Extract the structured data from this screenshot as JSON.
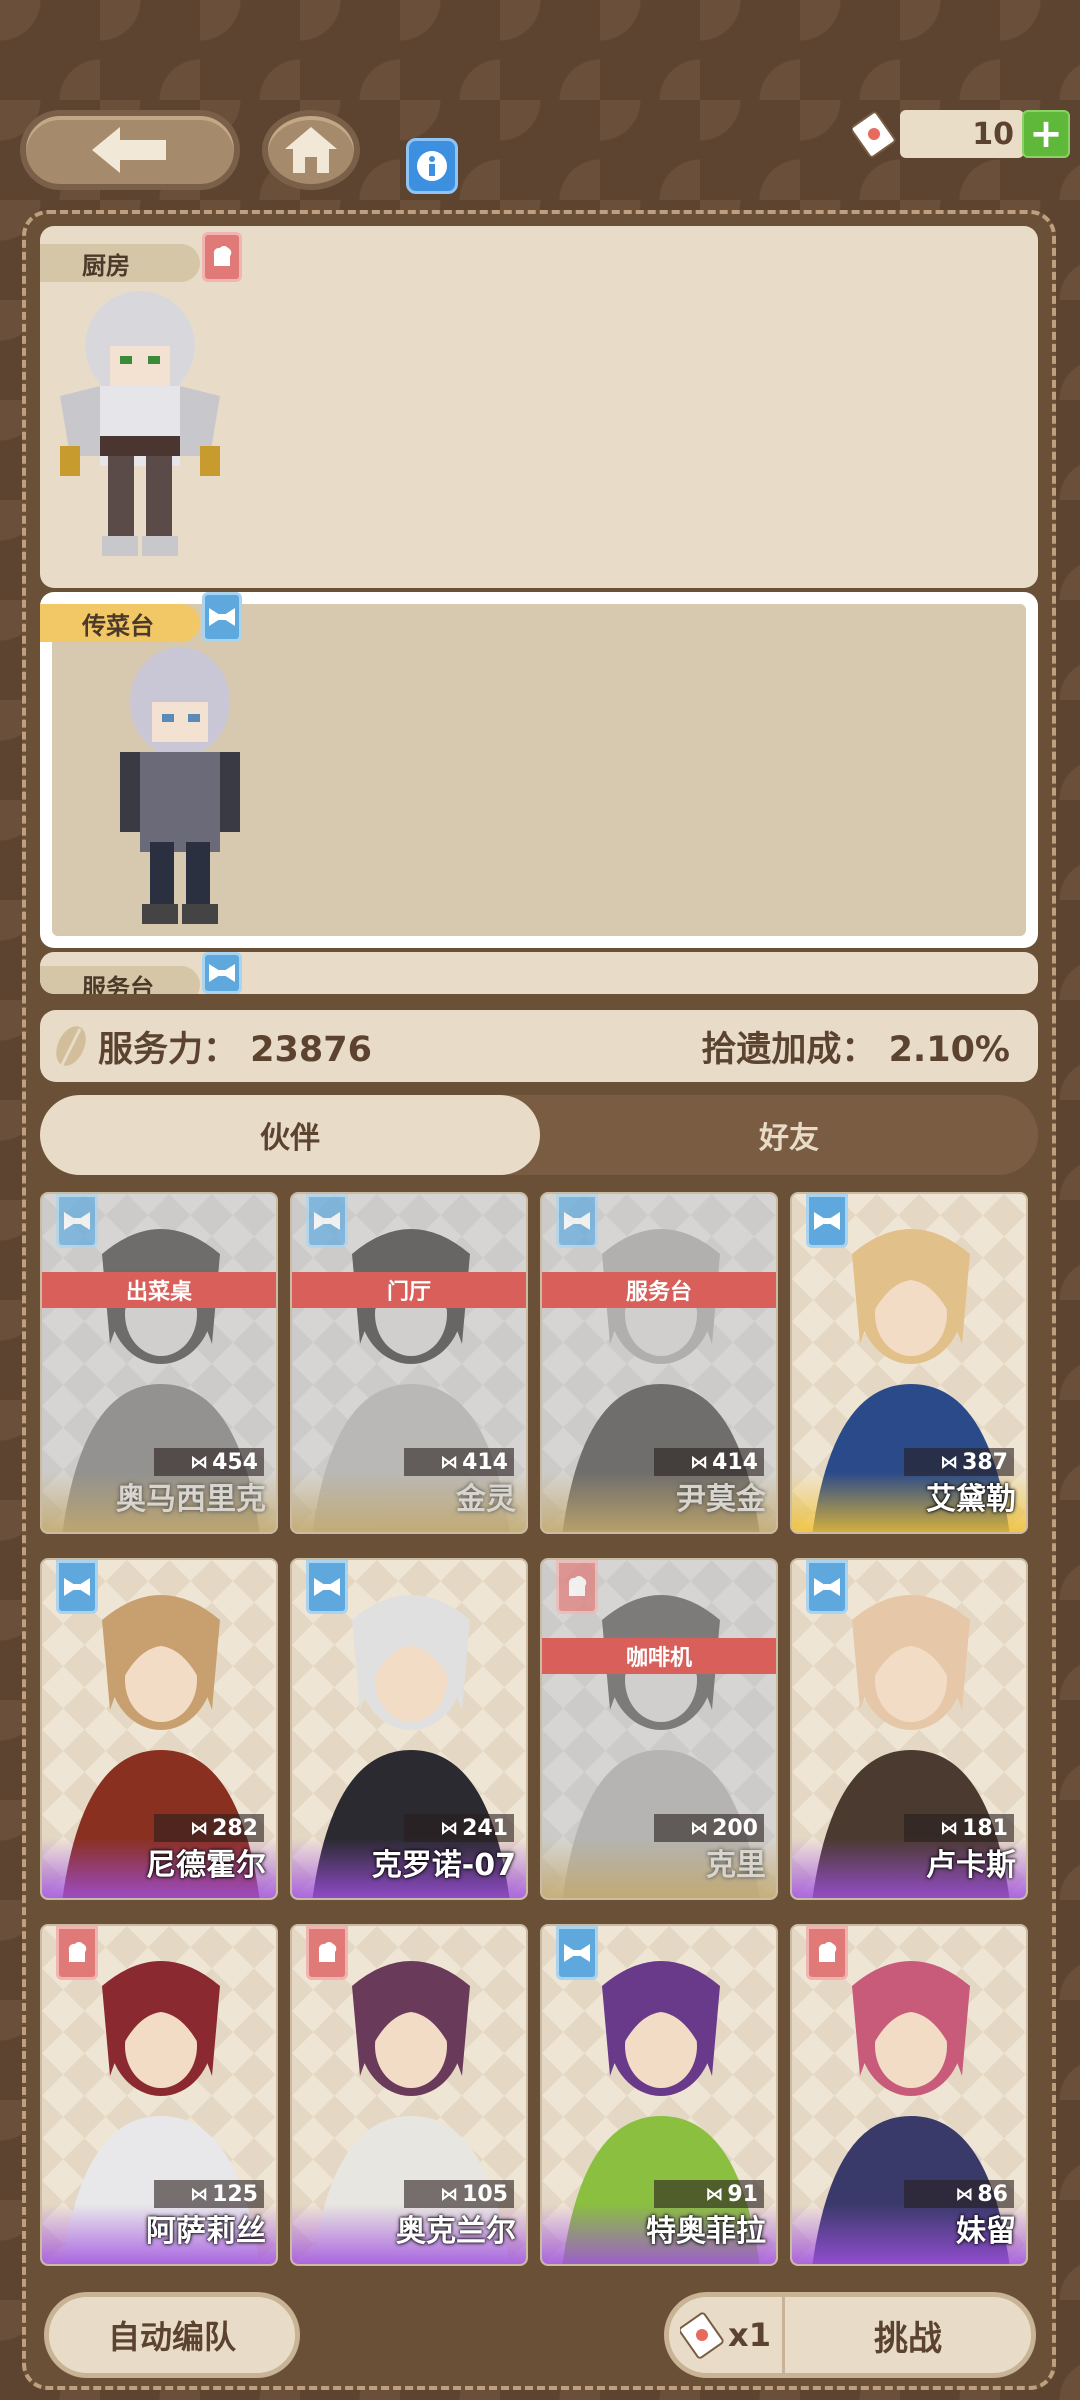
{
  "header": {
    "ticket_count": "10",
    "plus_label": "+"
  },
  "stations": [
    {
      "label": "厨房",
      "badge": "red",
      "selected": false
    },
    {
      "label": "传菜台",
      "badge": "blue",
      "selected": true
    },
    {
      "label": "服务台",
      "badge": "blue",
      "selected": false
    }
  ],
  "stats": {
    "service_power": "服务力：  23876",
    "pickup_bonus": "拾遗加成：  2.10%"
  },
  "tabs": [
    {
      "label": "伙伴",
      "active": true
    },
    {
      "label": "好友",
      "active": false
    }
  ],
  "cards": [
    {
      "name": "奥马西里克",
      "power": "454",
      "badge": "blue",
      "assigned": "出菜桌",
      "gray": true
    },
    {
      "name": "金灵",
      "power": "414",
      "badge": "blue",
      "assigned": "门厅",
      "gray": true
    },
    {
      "name": "尹莫金",
      "power": "414",
      "badge": "blue",
      "assigned": "服务台",
      "gray": true
    },
    {
      "name": "艾黛勒",
      "power": "387",
      "badge": "blue",
      "assigned": "",
      "gray": false
    },
    {
      "name": "尼德霍尔",
      "power": "282",
      "badge": "blue",
      "assigned": "",
      "gray": false
    },
    {
      "name": "克罗诺-07",
      "power": "241",
      "badge": "blue",
      "assigned": "",
      "gray": false
    },
    {
      "name": "克里",
      "power": "200",
      "badge": "red",
      "assigned": "咖啡机",
      "gray": true
    },
    {
      "name": "卢卡斯",
      "power": "181",
      "badge": "blue",
      "assigned": "",
      "gray": false
    },
    {
      "name": "阿萨莉丝",
      "power": "125",
      "badge": "red",
      "assigned": "",
      "gray": false
    },
    {
      "name": "奥克兰尔",
      "power": "105",
      "badge": "red",
      "assigned": "",
      "gray": false
    },
    {
      "name": "特奥菲拉",
      "power": "91",
      "badge": "blue",
      "assigned": "",
      "gray": false
    },
    {
      "name": "妹留",
      "power": "86",
      "badge": "red",
      "assigned": "",
      "gray": false
    }
  ],
  "footer": {
    "auto_label": "自动编队",
    "cost_label": "x1",
    "challenge_label": "挑战"
  },
  "colors": {
    "accent_red": "#d95f5a",
    "accent_blue": "#5ea8dd",
    "panel": "#e8dcc8",
    "frame": "#6b5038"
  }
}
